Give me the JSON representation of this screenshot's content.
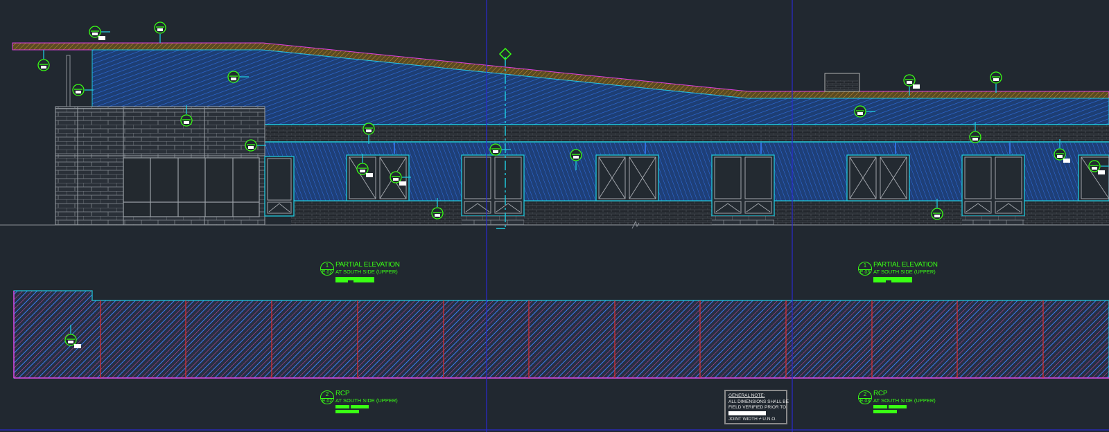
{
  "drawing": {
    "elevation_upper_left": {
      "number": "1",
      "sheet": "E.02",
      "title": "PARTIAL ELEVATION",
      "subtitle": "AT SOUTH SIDE (UPPER)"
    },
    "elevation_upper_right": {
      "number": "1",
      "sheet": "E.03",
      "title": "PARTIAL ELEVATION",
      "subtitle": "AT SOUTH SIDE (UPPER)"
    },
    "rcp_left": {
      "number": "2",
      "sheet": "E.02",
      "title": "RCP",
      "subtitle": "AT SOUTH SIDE (UPPER)"
    },
    "rcp_right": {
      "number": "2",
      "sheet": "E.03",
      "title": "RCP",
      "subtitle": "AT SOUTH SIDE (UPPER)"
    },
    "general_note": {
      "title": "GENERAL NOTE:",
      "lines": [
        "ALL DIMENSIONS SHALL BE",
        "FIELD VERIFIED PRIOR TO"
      ],
      "last_line": "JOINT WIDTH",
      "last_suffix": "U.N.O."
    }
  },
  "colors": {
    "background": "#212830",
    "tag_green": "#39ff14",
    "cyan": "#1fc8dc",
    "blue_hatch": "#2f6fe0",
    "magenta": "#e040e0",
    "red": "#e03030",
    "viewport_line": "#2a2ad0"
  }
}
